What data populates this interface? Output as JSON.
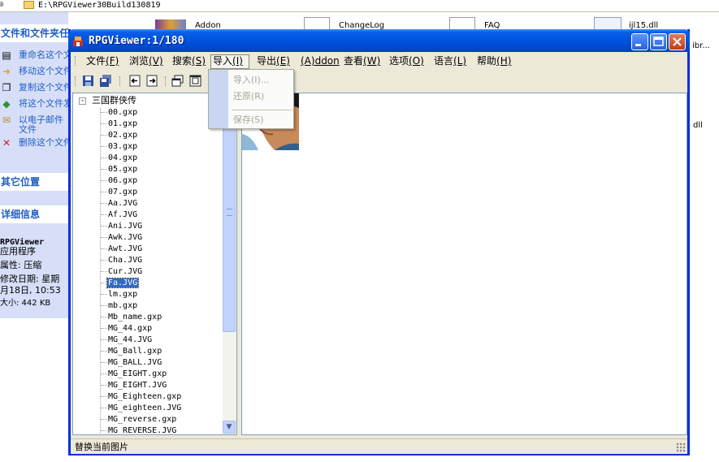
{
  "explorer": {
    "address_path": "E:\\RPGViewer30Build130819",
    "files": [
      {
        "name": "Addon"
      },
      {
        "name": "ChangeLog"
      },
      {
        "name": "FAQ"
      },
      {
        "name": "ijl15.dll"
      },
      {
        "name": "ibr..."
      },
      {
        "name": "dll"
      }
    ],
    "tasks_title": "文件和文件夹任务",
    "tasks": [
      "重命名这个文件",
      "移动这个文件",
      "复制这个文件",
      "将这个文件发布",
      "以电子邮件",
      "文件",
      "删除这个文件"
    ],
    "other_places_title": "其它位置",
    "details_title": "详细信息",
    "details": {
      "name": "RPGViewer",
      "type": "应用程序",
      "attr": "属性: 压缩",
      "modified_1": "修改日期: 星期",
      "modified_2": "月18日, 10:53",
      "size": "大小: 442 KB"
    }
  },
  "window": {
    "title": "RPGViewer:1/180",
    "menu": [
      {
        "label": "文件",
        "key": "(F)"
      },
      {
        "label": "浏览",
        "key": "(V)"
      },
      {
        "label": "搜索",
        "key": "(S)"
      },
      {
        "label": "导入",
        "key": "(I)"
      },
      {
        "label": "导出",
        "key": "(E)"
      },
      {
        "label": "",
        "key": "(A)ddon"
      },
      {
        "label": "查看",
        "key": "(W)"
      },
      {
        "label": "选项",
        "key": "(O)"
      },
      {
        "label": "语言",
        "key": "(L)"
      },
      {
        "label": "帮助",
        "key": "(H)"
      }
    ],
    "import_menu": [
      "导入(I)...",
      "还原(R)",
      "保存(S)"
    ],
    "tree_root": "三国群侠传",
    "tree_items": [
      "00.gxp",
      "01.gxp",
      "02.gxp",
      "03.gxp",
      "04.gxp",
      "05.gxp",
      "06.gxp",
      "07.gxp",
      "Aa.JVG",
      "Af.JVG",
      "Ani.JVG",
      "Awk.JVG",
      "Awt.JVG",
      "Cha.JVG",
      "Cur.JVG",
      "Fa.JVG",
      "lm.gxp",
      "mb.gxp",
      "Mb_name.gxp",
      "MG_44.gxp",
      "MG_44.JVG",
      "MG_Ball.gxp",
      "MG_BALL.JVG",
      "MG_EIGHT.gxp",
      "MG_EIGHT.JVG",
      "MG_Eighteen.gxp",
      "MG_eighteen.JVG",
      "MG_reverse.gxp",
      "MG_REVERSE.JVG"
    ],
    "selected_item": "Fa.JVG",
    "status": "替换当前图片"
  },
  "colors": {
    "title_blue": "#0052e0",
    "selection": "#316ac5",
    "task_link": "#215dc6",
    "pane_bg": "#d6dff7",
    "chrome": "#ece9d8"
  }
}
